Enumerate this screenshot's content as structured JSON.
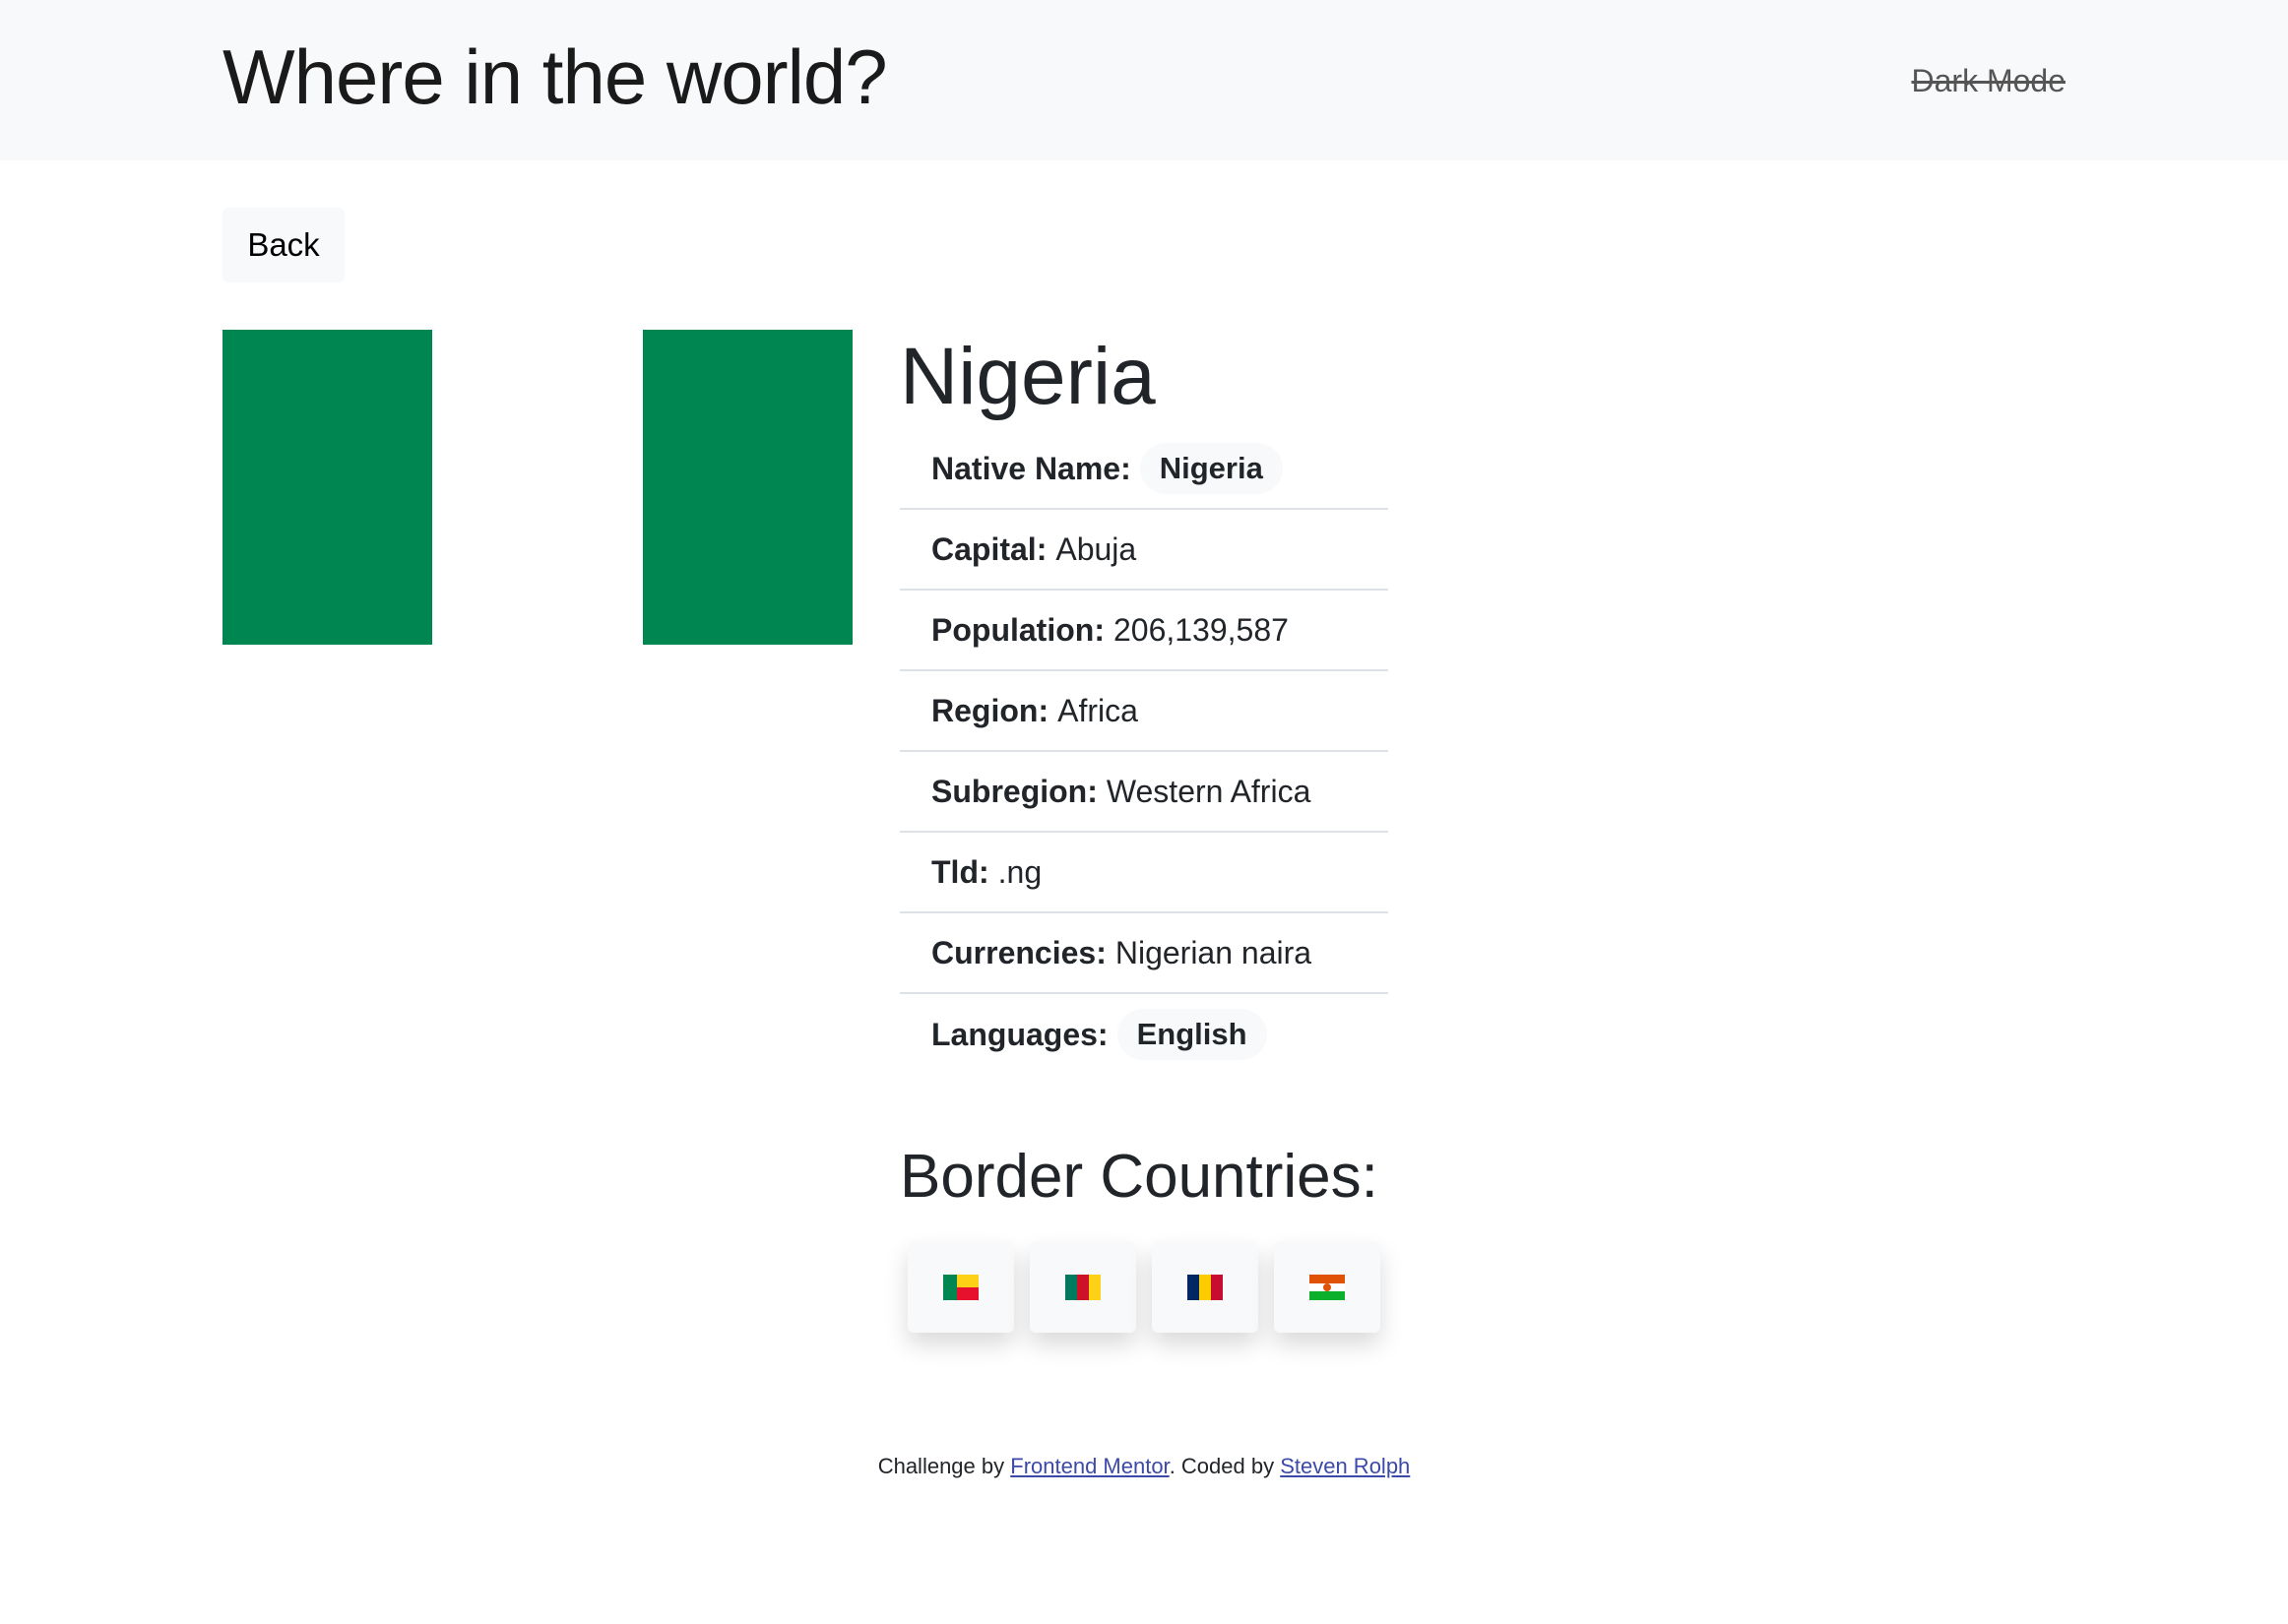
{
  "header": {
    "title": "Where in the world?",
    "dark_mode_label": "Dark Mode"
  },
  "back_button": {
    "label": "Back"
  },
  "flag": {
    "icon": "nigeria-flag",
    "colors": [
      "#008751",
      "#ffffff",
      "#008751"
    ]
  },
  "country": {
    "name": "Nigeria",
    "details": [
      {
        "label": "Native Name:",
        "value": "Nigeria"
      },
      {
        "label": "Capital:",
        "value": "Abuja"
      },
      {
        "label": "Population:",
        "value": "206,139,587"
      },
      {
        "label": "Region:",
        "value": "Africa"
      },
      {
        "label": "Subregion:",
        "value": "Western Africa"
      },
      {
        "label": "Tld:",
        "value": ".ng"
      },
      {
        "label": "Currencies:",
        "value": "Nigerian naira"
      },
      {
        "label": "Languages:",
        "value": "English"
      }
    ]
  },
  "borders": {
    "title": "Border Countries:",
    "countries": [
      {
        "icon": "benin-flag-icon",
        "flag": "🇧🇯"
      },
      {
        "icon": "cameroon-flag-icon",
        "flag": "🇨🇲"
      },
      {
        "icon": "chad-flag-icon",
        "flag": "🇹🇩"
      },
      {
        "icon": "niger-flag-icon",
        "flag": "🇳🇪"
      }
    ]
  },
  "footer": {
    "prefix": "Challenge by ",
    "link1": "Frontend Mentor",
    "middle": ". Coded by ",
    "link2": "Steven Rolph"
  },
  "colors": {
    "header_bg": "#f8f9fa",
    "nigeria_green": "#008751",
    "link": "#3b4aa8"
  }
}
